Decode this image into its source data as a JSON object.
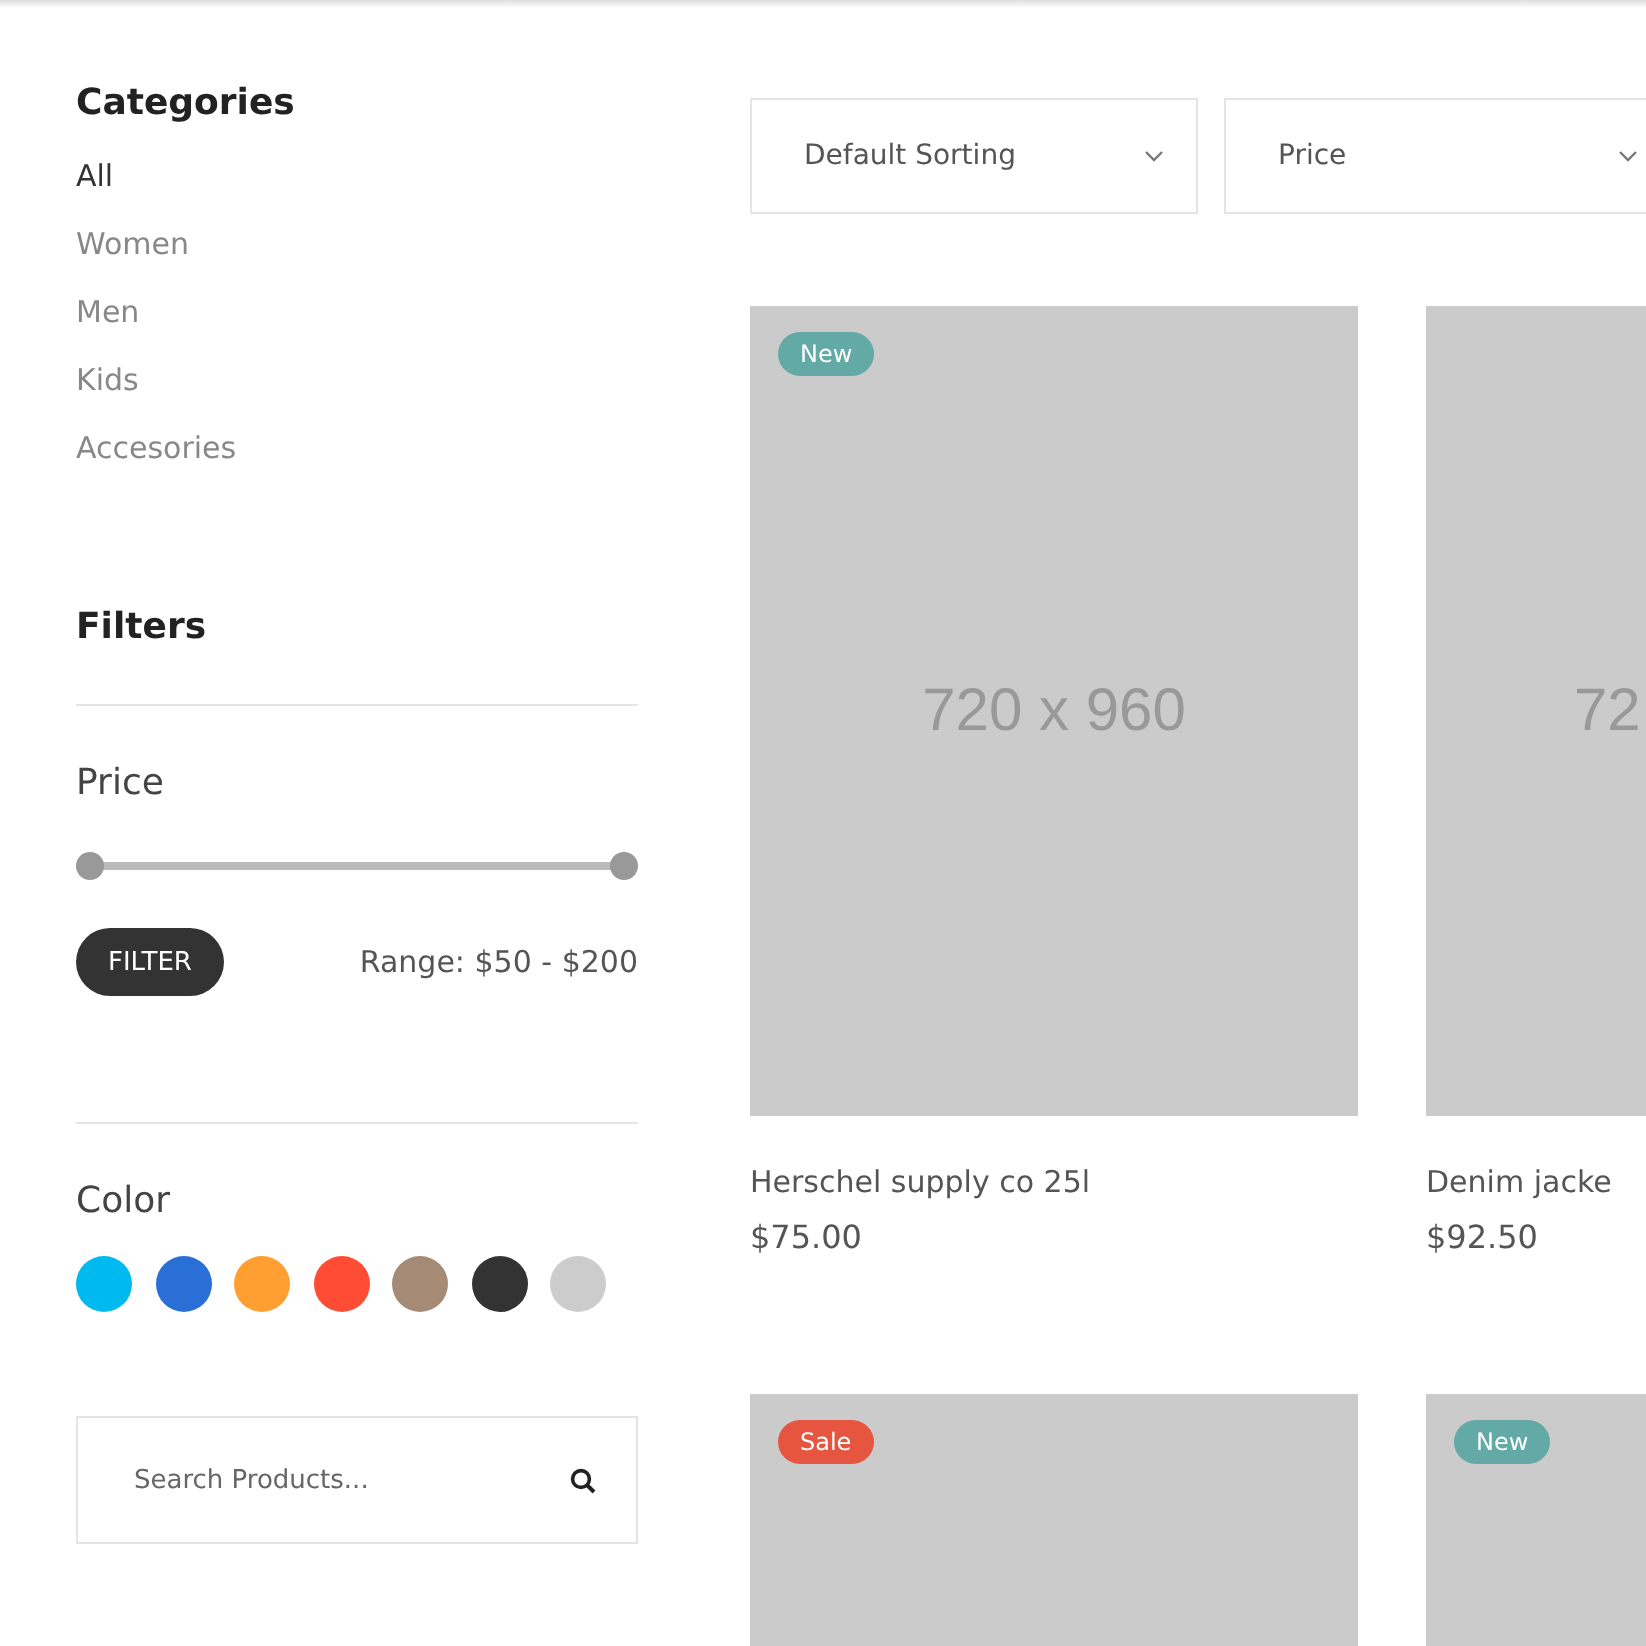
{
  "categories": {
    "title": "Categories",
    "items": [
      {
        "label": "All",
        "selected": true
      },
      {
        "label": "Women",
        "selected": false
      },
      {
        "label": "Men",
        "selected": false
      },
      {
        "label": "Kids",
        "selected": false
      },
      {
        "label": "Accesories",
        "selected": false
      }
    ]
  },
  "filters": {
    "title": "Filters"
  },
  "price": {
    "title": "Price",
    "thumbs": [
      {
        "level": 0
      },
      {
        "level": 1
      }
    ],
    "button": "FILTER",
    "range": "Range: $50 - $200"
  },
  "color": {
    "title": "Color",
    "swatches": [
      {
        "color": "#00b9ee"
      },
      {
        "color": "#2a6fd6"
      },
      {
        "color": "#ff9f31"
      },
      {
        "color": "#ff4d35"
      },
      {
        "color": "#a58a75"
      },
      {
        "color": "#333333"
      },
      {
        "color": "#cccccc"
      }
    ]
  },
  "search": {
    "placeholder": "Search Products..."
  },
  "selects": [
    {
      "value": "Default Sorting"
    },
    {
      "value": "Price"
    }
  ],
  "products": [
    {
      "badge": "New",
      "color": "#63a9a6",
      "image_label": "720 x 960",
      "name": "Herschel supply co 25l",
      "price": "$75.00"
    },
    {
      "image_label": "72",
      "clipped": true,
      "name": "Denim jacke",
      "price": "$92.50"
    },
    {
      "badge": "Sale",
      "color": "#e65540"
    },
    {
      "badge": "New",
      "color": "#63a9a6"
    }
  ]
}
